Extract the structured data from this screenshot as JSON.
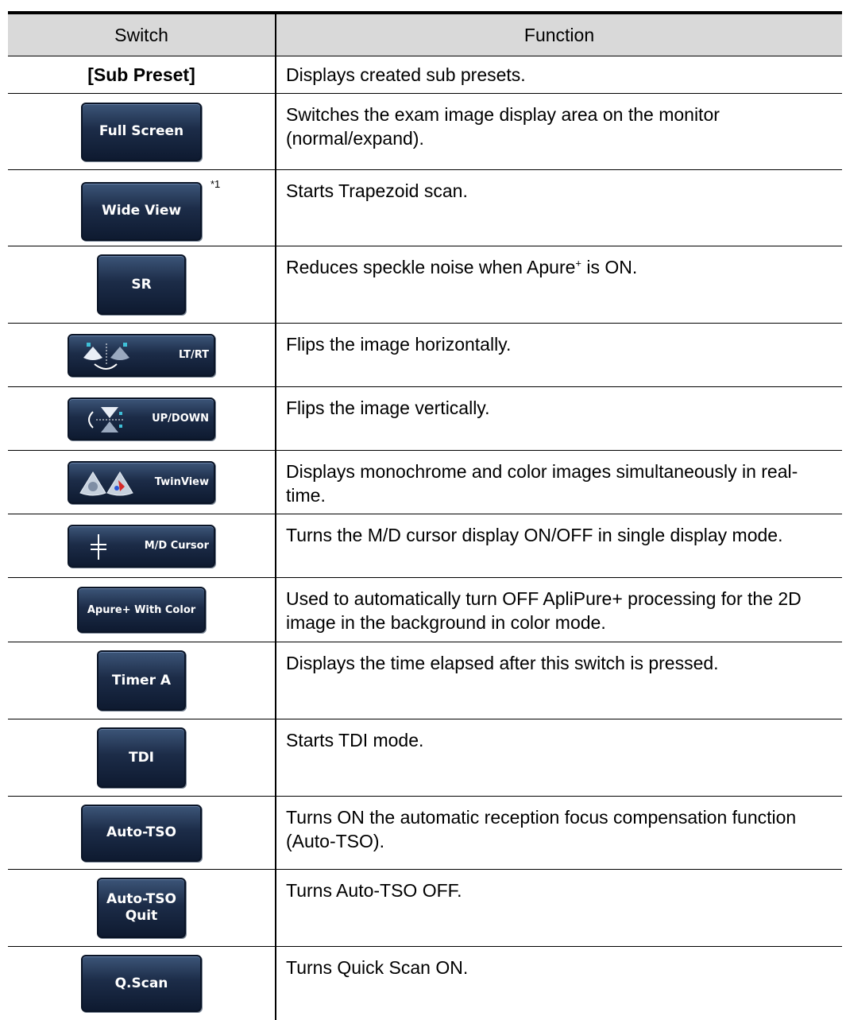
{
  "header": {
    "switch": "Switch",
    "function": "Function"
  },
  "rows": [
    {
      "switch": "[Sub Preset]",
      "function": "Displays created sub presets."
    },
    {
      "switch": "Full Screen",
      "function": "Switches the exam image display area on the monitor (normal/expand)."
    },
    {
      "switch": "Wide View",
      "note": "*1",
      "function": "Starts Trapezoid scan."
    },
    {
      "switch": "SR",
      "function_before": "Reduces speckle noise when Apure",
      "function_sup": "+",
      "function_after": " is ON."
    },
    {
      "switch": "LT/RT",
      "icon": "flip-horizontal-icon",
      "function": "Flips the image horizontally."
    },
    {
      "switch": "UP/DOWN",
      "icon": "flip-vertical-icon",
      "function": "Flips the image vertically."
    },
    {
      "switch": "TwinView",
      "icon": "twin-view-icon",
      "function": "Displays monochrome and color images simultaneously in real-time."
    },
    {
      "switch": "M/D Cursor",
      "icon": "md-cursor-icon",
      "function": "Turns the M/D cursor display ON/OFF in single display mode."
    },
    {
      "switch": "Apure+ With Color",
      "function": "Used to automatically turn OFF ApliPure+ processing for the 2D image in the background in color mode."
    },
    {
      "switch": "Timer A",
      "function": "Displays the time elapsed after this switch is pressed."
    },
    {
      "switch": "TDI",
      "function": "Starts TDI mode."
    },
    {
      "switch": "Auto-TSO",
      "function": "Turns ON the automatic reception focus compensation function (Auto-TSO)."
    },
    {
      "switch_line1": "Auto-TSO",
      "switch_line2": "Quit",
      "function": "Turns Auto-TSO OFF."
    },
    {
      "switch": "Q.Scan",
      "function": "Turns Quick Scan ON."
    }
  ],
  "colors": {
    "button_top": "#3c5578",
    "button_bottom": "#0e1a30",
    "header_bg": "#d9d9d9"
  }
}
